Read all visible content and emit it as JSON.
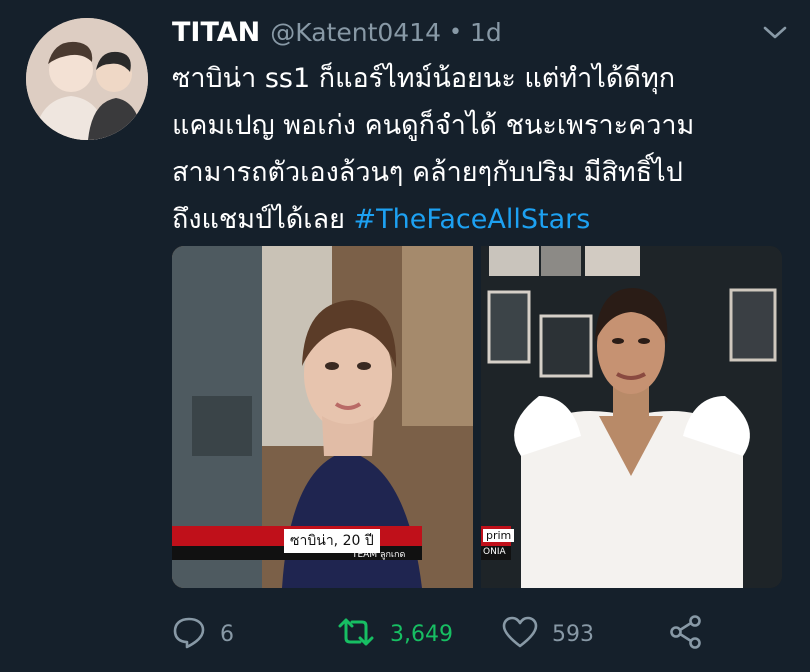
{
  "tweet": {
    "author_name": "TITAN",
    "handle": "@Katent0414",
    "separator": "•",
    "time": "1d",
    "text_lines": [
      "ซาบิน่า ss1 ก็แอร์ไทม์น้อยนะ แต่ทำได้ดีทุก",
      "แคมเปญ พอเก่ง คนดูก็จำได้ ชนะเพราะความ",
      "สามารถตัวเองล้วนๆ คล้ายๆกับปริม มีสิทธิ์ไป",
      "ถึงแชมป์ได้เลย"
    ],
    "hashtag": "#TheFaceAllStars"
  },
  "media": {
    "left": {
      "caption_name": "ซาบิน่า, 20 ปี",
      "caption_team": "TEAM ลูกเกด"
    },
    "right": {
      "caption_name": "prim",
      "caption_team": "ONIA"
    }
  },
  "actions": {
    "reply_count": "6",
    "retweet_count": "3,649",
    "like_count": "593"
  },
  "colors": {
    "background": "#15202b",
    "muted": "#8899a6",
    "link": "#1da1f2",
    "retweet": "#17bf63"
  },
  "icons": [
    "chevron-down-icon",
    "reply-icon",
    "retweet-icon",
    "like-icon",
    "share-icon"
  ]
}
